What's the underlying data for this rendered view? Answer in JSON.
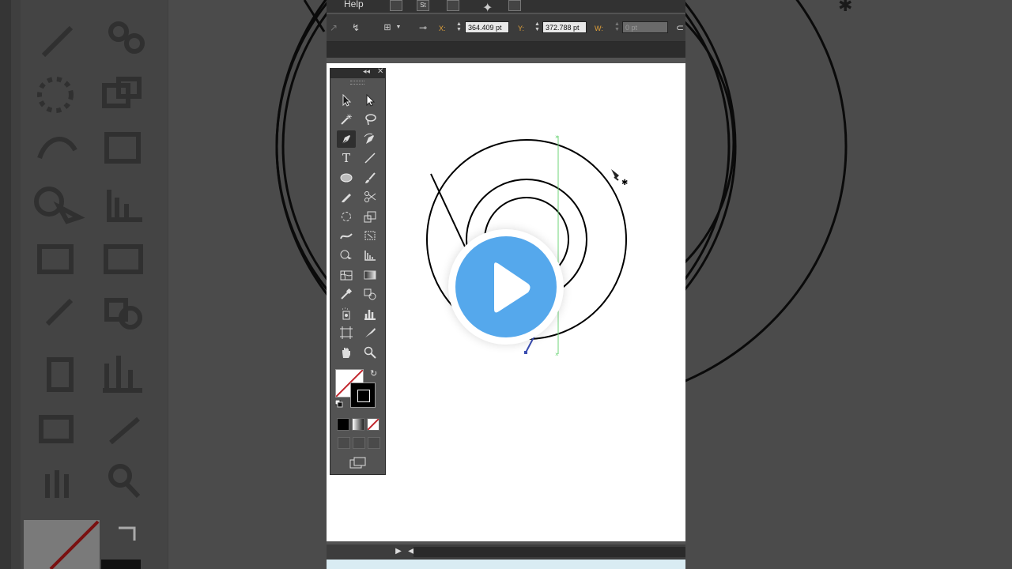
{
  "menu": {
    "help_label": "Help"
  },
  "control_bar": {
    "x_label": "X:",
    "x_value": "364.409 pt",
    "y_label": "Y:",
    "y_value": "372.788 pt",
    "w_label": "W:",
    "w_value": "0 pt"
  },
  "tools_panel": {
    "text_tool_glyph": "T"
  },
  "colors": {
    "accent_orange": "#e0a03a",
    "play_blue": "#55a8ec",
    "guide_green": "#6fd47a"
  },
  "icons": [
    "selection-tool-icon",
    "direct-selection-tool-icon",
    "magic-wand-tool-icon",
    "lasso-tool-icon",
    "pen-tool-icon",
    "curvature-pen-tool-icon",
    "type-tool-icon",
    "line-segment-tool-icon",
    "ellipse-tool-icon",
    "paintbrush-tool-icon",
    "pencil-tool-icon",
    "scissors-tool-icon",
    "rotate-tool-icon",
    "scale-tool-icon",
    "width-tool-icon",
    "free-transform-tool-icon",
    "shape-builder-tool-icon",
    "graph-tool-icon",
    "mesh-tool-icon",
    "gradient-tool-icon",
    "eyedropper-tool-icon",
    "blend-tool-icon",
    "symbol-sprayer-tool-icon",
    "column-graph-tool-icon",
    "artboard-tool-icon",
    "slice-tool-icon",
    "hand-tool-icon",
    "zoom-tool-icon",
    "play-icon"
  ]
}
